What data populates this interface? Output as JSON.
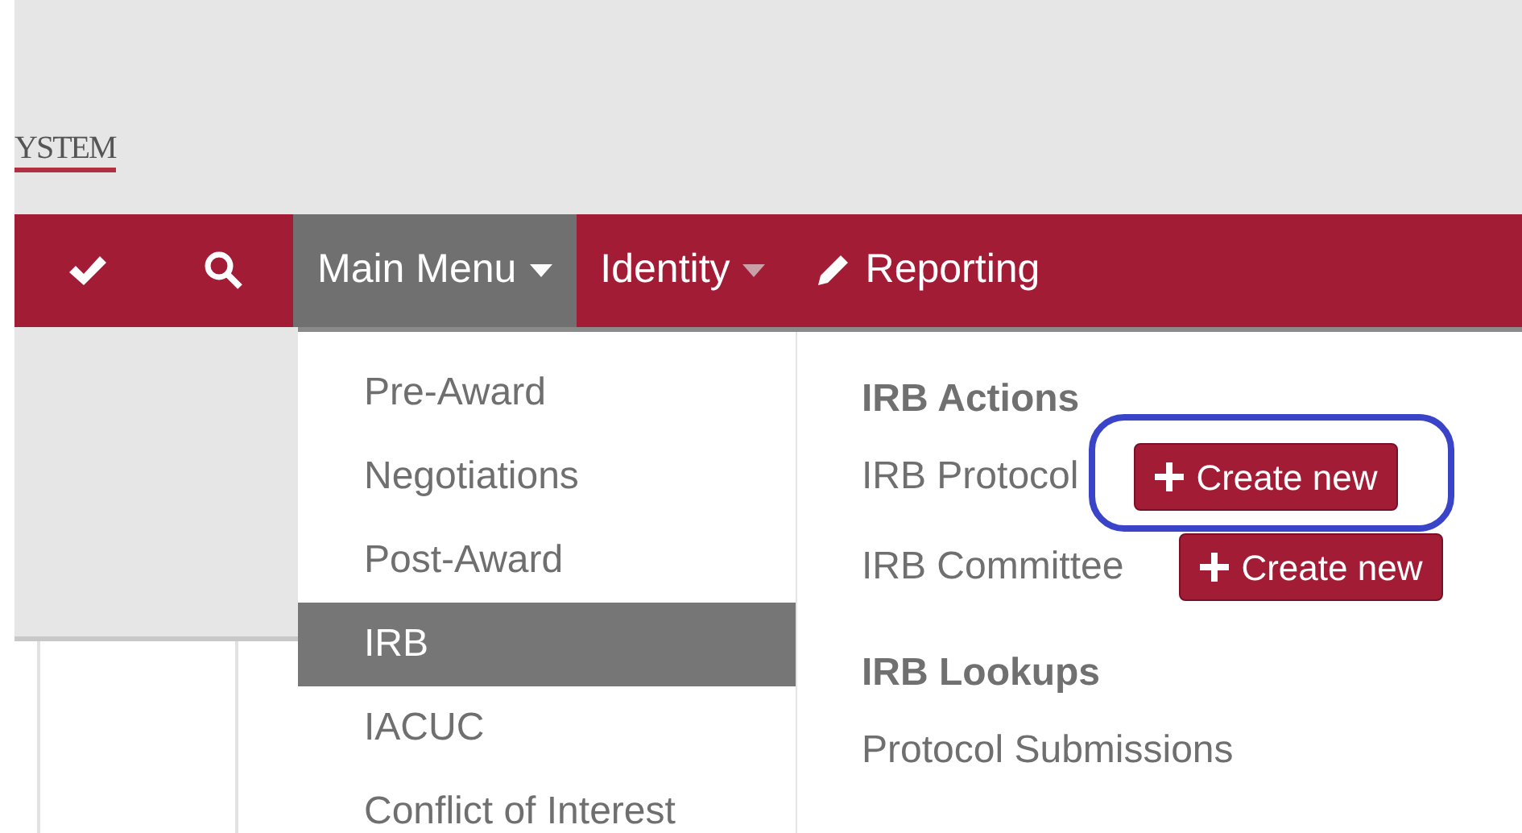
{
  "header": {
    "brand": "YSTEM"
  },
  "navbar": {
    "items": [
      {
        "label": "Main Menu",
        "kind": "dropdown",
        "selected": true
      },
      {
        "label": "Identity",
        "kind": "dropdown",
        "selected": false
      },
      {
        "label": "Reporting",
        "kind": "link",
        "selected": false
      }
    ]
  },
  "main_menu": {
    "items": [
      {
        "label": "Pre-Award",
        "selected": false
      },
      {
        "label": "Negotiations",
        "selected": false
      },
      {
        "label": "Post-Award",
        "selected": false
      },
      {
        "label": "IRB",
        "selected": true
      },
      {
        "label": "IACUC",
        "selected": false
      },
      {
        "label": "Conflict of Interest",
        "selected": false
      }
    ]
  },
  "submenu": {
    "sections": [
      {
        "heading": "IRB Actions",
        "entries": [
          {
            "label": "IRB Protocol",
            "button": "Create new",
            "highlighted": true
          },
          {
            "label": "IRB Committee",
            "button": "Create new",
            "highlighted": false
          }
        ]
      },
      {
        "heading": "IRB Lookups",
        "entries": [
          {
            "label": "Protocol Submissions"
          }
        ]
      }
    ]
  }
}
